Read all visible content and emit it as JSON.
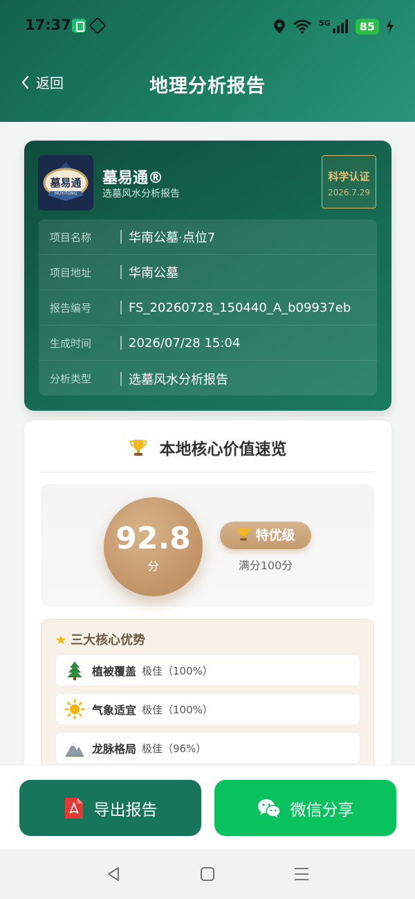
{
  "status_bar": {
    "time": "17:37",
    "network": "5G",
    "battery": "85"
  },
  "nav": {
    "back_label": "返回",
    "title": "地理分析报告"
  },
  "report": {
    "brand_name": "墓易通®",
    "brand_subtitle": "选墓风水分析报告",
    "logo_text": "墓易通",
    "logo_subtext": "MUYITONG",
    "cert_title": "科学认证",
    "cert_date": "2026.7.29",
    "fields": [
      {
        "label": "项目名称",
        "value": "华南公墓·点位7"
      },
      {
        "label": "项目地址",
        "value": "华南公墓"
      },
      {
        "label": "报告编号",
        "value": "FS_20260728_150440_A_b09937eb"
      },
      {
        "label": "生成时间",
        "value": "2026/07/28 15:04"
      },
      {
        "label": "分析类型",
        "value": "选墓风水分析报告"
      }
    ]
  },
  "value_overview": {
    "title": "本地核心价值速览",
    "score": "92.8",
    "score_unit": "分",
    "grade": "特优级",
    "full_score": "满分100分",
    "advantages_title": "三大核心优势",
    "advantages": [
      {
        "icon": "evergreen-tree-icon",
        "name": "植被覆盖",
        "rating": "极佳（100%）"
      },
      {
        "icon": "sun-icon",
        "name": "气象适宜",
        "rating": "极佳（100%）"
      },
      {
        "icon": "mountain-icon",
        "name": "龙脉格局",
        "rating": "极佳（96%）"
      }
    ]
  },
  "actions": {
    "export_label": "导出报告",
    "share_label": "微信分享"
  },
  "colors": {
    "header_green": "#1c7e63",
    "card_green": "#166a52",
    "gold": "#c4986a",
    "wechat_green": "#09c25d"
  }
}
